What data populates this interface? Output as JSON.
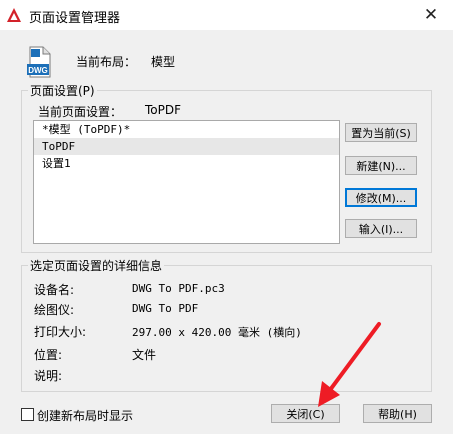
{
  "window": {
    "title": "页面设置管理器"
  },
  "layout": {
    "label": "当前布局：",
    "value": "模型"
  },
  "page_setups": {
    "legend": "页面设置(P)",
    "current_label": "当前页面设置：",
    "current_value": "ToPDF",
    "items": [
      "*模型 (ToPDF)*",
      "ToPDF",
      "设置1"
    ],
    "selected_index": 1
  },
  "buttons": {
    "set_current": "置为当前(S)",
    "new": "新建(N)...",
    "modify": "修改(M)...",
    "import": "输入(I)...",
    "close": "关闭(C)",
    "help": "帮助(H)"
  },
  "details": {
    "legend": "选定页面设置的详细信息",
    "device_label": "设备名:",
    "device_value": "DWG To PDF.pc3",
    "plotter_label": "绘图仪:",
    "plotter_value": "DWG To PDF",
    "size_label": "打印大小:",
    "size_value": "297.00 x 420.00 毫米 (横向)",
    "location_label": "位置:",
    "location_value": "文件",
    "description_label": "说明:"
  },
  "checkbox": {
    "label": "创建新布局时显示",
    "checked": false
  },
  "icons": {
    "title": "autocad-logo-icon",
    "layout": "dwg-file-icon",
    "close": "close-icon",
    "annotation": "red-arrow-icon"
  },
  "colors": {
    "title_logo": "#d3222a",
    "focus_border": "#0078d7",
    "annotation_arrow": "#ee1c25"
  }
}
